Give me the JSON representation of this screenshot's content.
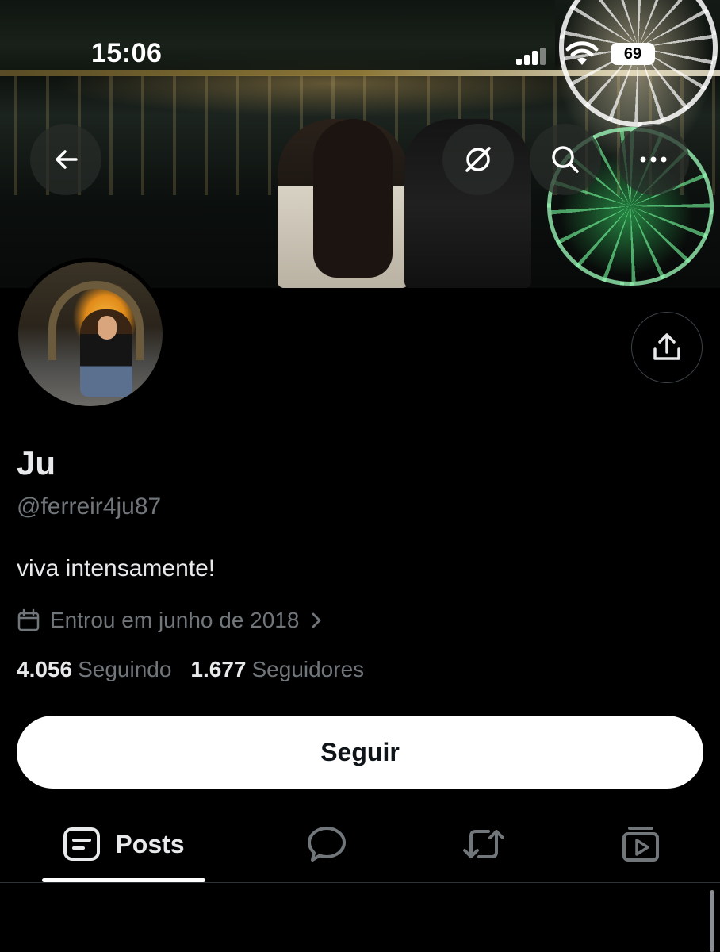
{
  "status_bar": {
    "time": "15:06",
    "battery": "69"
  },
  "profile": {
    "name": "Ju",
    "handle": "@ferreir4ju87",
    "bio": "viva intensamente!",
    "joined": "Entrou em junho de 2018"
  },
  "stats": {
    "following_count": "4.056",
    "following_label": "Seguindo",
    "followers_count": "1.677",
    "followers_label": "Seguidores"
  },
  "follow_button": {
    "label": "Seguir"
  },
  "tabs": [
    {
      "label": "Posts",
      "icon": "posts-icon",
      "active": true
    },
    {
      "label": "",
      "icon": "replies-icon",
      "active": false
    },
    {
      "label": "",
      "icon": "repost-icon",
      "active": false
    },
    {
      "label": "",
      "icon": "media-icon",
      "active": false
    }
  ],
  "header_buttons": [
    "back-icon",
    "grok-icon",
    "search-icon",
    "more-icon"
  ],
  "colors": {
    "background": "#000000",
    "text_primary": "#e7e9ea",
    "text_secondary": "#71767b",
    "button_bg": "#ffffff",
    "border": "#2f3336"
  }
}
